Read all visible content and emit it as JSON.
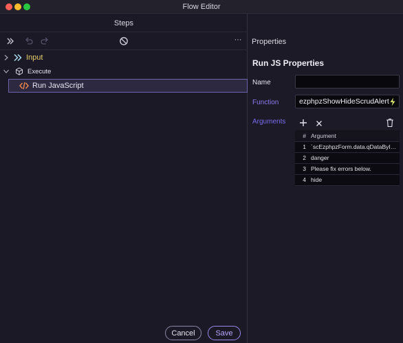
{
  "window": {
    "title": "Flow Editor"
  },
  "steps_panel": {
    "title": "Steps",
    "toolbar_more": "···",
    "tree": [
      {
        "label": "Input",
        "expanded": false
      },
      {
        "label": "Execute",
        "expanded": true,
        "children": [
          {
            "label": "Run JavaScript",
            "selected": true
          }
        ]
      }
    ]
  },
  "properties_panel": {
    "title": "Properties",
    "section_title": "Run JS Properties",
    "name_label": "Name",
    "name_value": "",
    "function_label": "Function",
    "function_value": "ezphpzShowHideScrudAlert",
    "arguments_label": "Arguments",
    "arguments_table": {
      "headers": [
        "#",
        "Argument"
      ],
      "rows": [
        {
          "index": "1",
          "value": "`scEzphpzForm.data.qDataById..."
        },
        {
          "index": "2",
          "value": "danger"
        },
        {
          "index": "3",
          "value": "Please fix errors below."
        },
        {
          "index": "4",
          "value": "hide"
        }
      ]
    }
  },
  "footer": {
    "cancel_label": "Cancel",
    "save_label": "Save"
  },
  "colors": {
    "accent": "#9a89f0",
    "input_step": "#e6d06a",
    "js_icon": "#e8864a",
    "function_label": "#8e7bf0",
    "arguments_label": "#7b6cf0"
  },
  "icons": {
    "toolbar": [
      "expand-all-icon",
      "undo-icon",
      "redo-icon",
      "disable-icon",
      "more-icon"
    ],
    "input_step": "double-chevron-right-icon",
    "execute_step": "cube-icon",
    "run_js_step": "code-brackets-icon",
    "function_picker": "lightning-bolt-icon",
    "args_tools": [
      "add-icon",
      "remove-icon",
      "trash-icon"
    ]
  }
}
